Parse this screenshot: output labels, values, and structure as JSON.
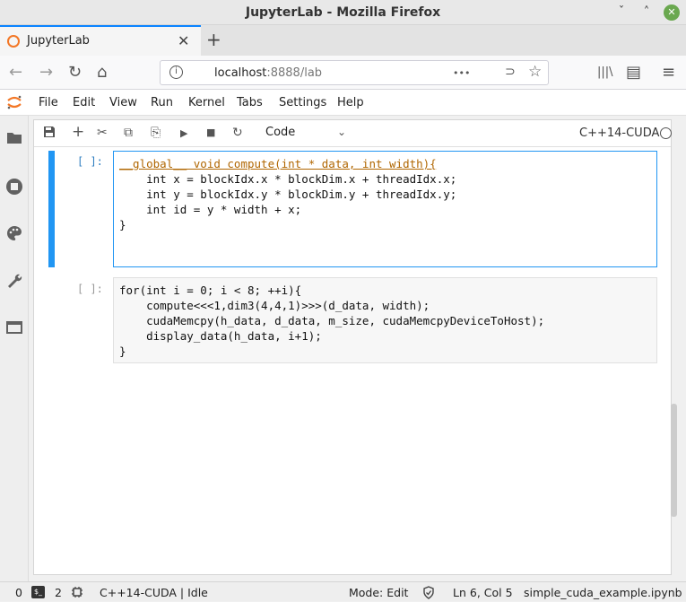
{
  "window": {
    "title": "JupyterLab - Mozilla Firefox",
    "minimize_glyph": "ˇ",
    "maximize_glyph": "˄",
    "close_glyph": "✕"
  },
  "browser": {
    "tab_label": "JupyterLab",
    "tab_close_glyph": "✕",
    "new_tab_glyph": "+",
    "url_host": "localhost",
    "url_rest": ":8888/lab",
    "more_glyph": "•••",
    "pocket_glyph": "⊃",
    "bookmark_glyph": "☆",
    "back_glyph": "←",
    "forward_glyph": "→",
    "reload_glyph": "↻",
    "home_glyph": "⌂",
    "library_glyph": "|||\\",
    "sidebar_glyph": "▤",
    "menu_glyph": "≡"
  },
  "menu": {
    "items": [
      "File",
      "Edit",
      "View",
      "Run",
      "Kernel",
      "Tabs",
      "Settings",
      "Help"
    ]
  },
  "toolbar": {
    "save_glyph": "▪",
    "add_glyph": "+",
    "cut_glyph": "✂",
    "copy_glyph": "⧉",
    "paste_glyph": "⎘",
    "run_glyph": "▶",
    "stop_glyph": "■",
    "restart_glyph": "↻",
    "cell_type": "Code",
    "cell_type_chevron": "⌄",
    "kernel": "C++14-CUDA"
  },
  "cells": [
    {
      "prompt": "[ ]:",
      "lines": [
        "__global__ void compute(int * data, int width){",
        "    int x = blockIdx.x * blockDim.x + threadIdx.x;",
        "    int y = blockIdx.y * blockDim.y + threadIdx.y;",
        "    int id = y * width + x;",
        "",
        "",
        "}"
      ]
    },
    {
      "prompt": "[ ]:",
      "lines": [
        "for(int i = 0; i < 8; ++i){",
        "    compute<<<1,dim3(4,4,1)>>>(d_data, width);",
        "    cudaMemcpy(h_data, d_data, m_size, cudaMemcpyDeviceToHost);",
        "    display_data(h_data, i+1);",
        "}"
      ]
    }
  ],
  "status": {
    "left_count_a": "0",
    "terminal_badge": "$_",
    "left_count_b": "2",
    "kernel_status": "C++14-CUDA | Idle",
    "mode": "Mode: Edit",
    "position": "Ln 6, Col 5",
    "filename": "simple_cuda_example.ipynb"
  },
  "sidebar": {
    "icons": [
      "folder-icon",
      "running-icon",
      "palette-icon",
      "wrench-icon",
      "tabs-icon"
    ]
  }
}
